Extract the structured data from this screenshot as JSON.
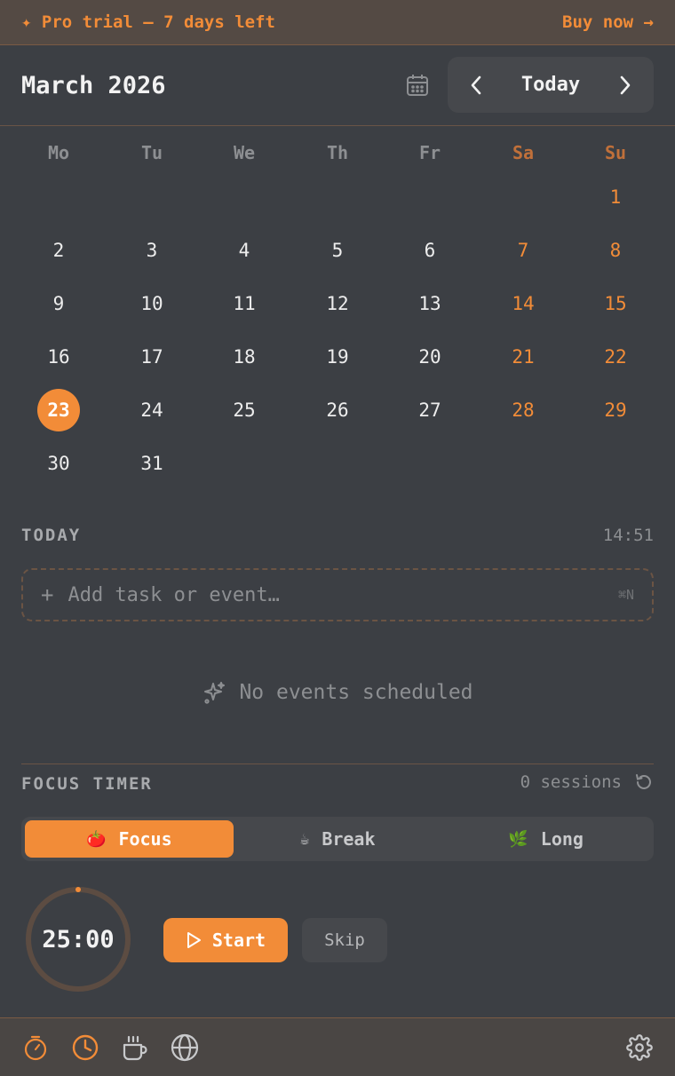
{
  "banner": {
    "trial_text": "✦ Pro trial — 7 days left",
    "buy_text": "Buy now →"
  },
  "header": {
    "month_title": "March 2026",
    "today_label": "Today"
  },
  "calendar": {
    "weekdays": [
      "Mo",
      "Tu",
      "We",
      "Th",
      "Fr",
      "Sa",
      "Su"
    ],
    "weeks": [
      [
        "",
        "",
        "",
        "",
        "",
        "",
        "1"
      ],
      [
        "2",
        "3",
        "4",
        "5",
        "6",
        "7",
        "8"
      ],
      [
        "9",
        "10",
        "11",
        "12",
        "13",
        "14",
        "15"
      ],
      [
        "16",
        "17",
        "18",
        "19",
        "20",
        "21",
        "22"
      ],
      [
        "23",
        "24",
        "25",
        "26",
        "27",
        "28",
        "29"
      ],
      [
        "30",
        "31",
        "",
        "",
        "",
        "",
        ""
      ]
    ],
    "selected_day": "23"
  },
  "today": {
    "label": "TODAY",
    "time": "14:51",
    "add_placeholder": "Add task or event…",
    "add_plus": "+",
    "shortcut": "⌘N",
    "empty_text": "No events scheduled"
  },
  "focus": {
    "label": "FOCUS TIMER",
    "sessions_text": "0 sessions",
    "tabs": [
      {
        "emoji": "🍅",
        "label": "Focus"
      },
      {
        "emoji": "☕",
        "label": "Break"
      },
      {
        "emoji": "🌿",
        "label": "Long"
      }
    ],
    "active_tab": 0,
    "time_display": "25:00",
    "progress": 0,
    "start_label": "Start",
    "skip_label": "Skip"
  },
  "bottom_bar": {
    "items": [
      "timer-icon",
      "clock-icon",
      "coffee-icon",
      "globe-icon"
    ],
    "settings": "gear-icon"
  },
  "colors": {
    "accent": "#f28c38",
    "background": "#3c3f44",
    "banner_bg": "#544a44",
    "muted": "#8d8f92"
  }
}
